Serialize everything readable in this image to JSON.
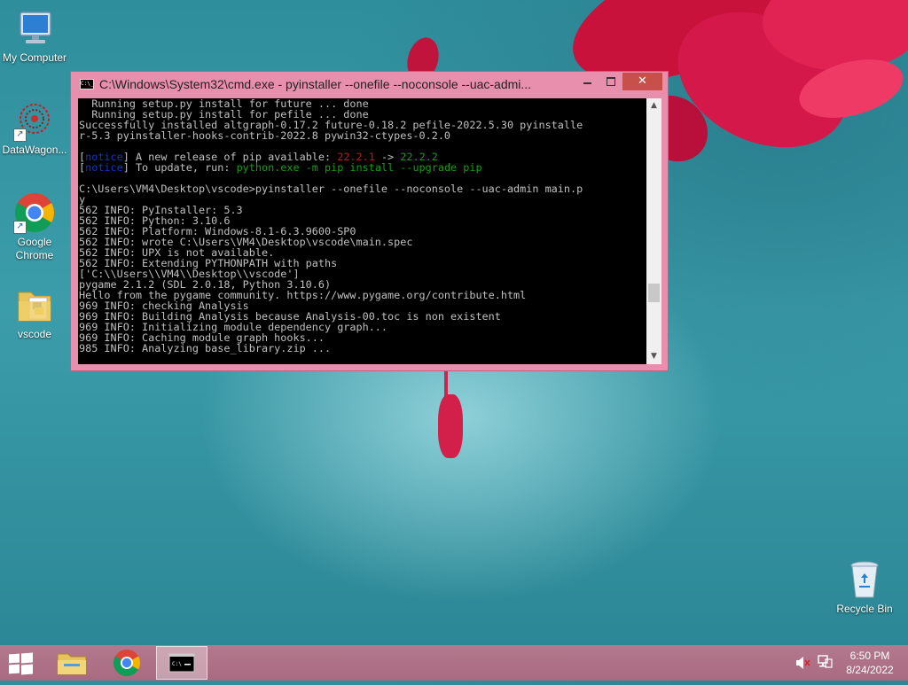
{
  "desktop": {
    "icons": [
      {
        "label": "My Computer",
        "icon": "computer-icon"
      },
      {
        "label": "DataWagon...",
        "icon": "datawagon-icon"
      },
      {
        "label": "Google Chrome",
        "icon": "chrome-icon"
      },
      {
        "label": "vscode",
        "icon": "folder-icon"
      },
      {
        "label": "Recycle Bin",
        "icon": "recycle-bin-icon"
      }
    ]
  },
  "window": {
    "title": "C:\\Windows\\System32\\cmd.exe - pyinstaller  --onefile --noconsole --uac-admi...",
    "close_label": "✕",
    "console_lines": [
      [
        {
          "t": "  Running setup.py install for future ... done"
        }
      ],
      [
        {
          "t": "  Running setup.py install for pefile ... done"
        }
      ],
      [
        {
          "t": "Successfully installed altgraph-0.17.2 future-0.18.2 pefile-2022.5.30 pyinstalle"
        }
      ],
      [
        {
          "t": "r-5.3 pyinstaller-hooks-contrib-2022.8 pywin32-ctypes-0.2.0"
        }
      ],
      [
        {
          "t": ""
        }
      ],
      [
        {
          "t": "["
        },
        {
          "t": "notice",
          "c": "blue"
        },
        {
          "t": "] A new release of pip available: "
        },
        {
          "t": "22.2.1",
          "c": "red"
        },
        {
          "t": " -> "
        },
        {
          "t": "22.2.2",
          "c": "green"
        }
      ],
      [
        {
          "t": "["
        },
        {
          "t": "notice",
          "c": "blue"
        },
        {
          "t": "] To update, run: "
        },
        {
          "t": "python.exe -m pip install --upgrade pip",
          "c": "green"
        }
      ],
      [
        {
          "t": ""
        }
      ],
      [
        {
          "t": "C:\\Users\\VM4\\Desktop\\vscode>pyinstaller --onefile --noconsole --uac-admin main.p"
        }
      ],
      [
        {
          "t": "y"
        }
      ],
      [
        {
          "t": "562 INFO: PyInstaller: 5.3"
        }
      ],
      [
        {
          "t": "562 INFO: Python: 3.10.6"
        }
      ],
      [
        {
          "t": "562 INFO: Platform: Windows-8.1-6.3.9600-SP0"
        }
      ],
      [
        {
          "t": "562 INFO: wrote C:\\Users\\VM4\\Desktop\\vscode\\main.spec"
        }
      ],
      [
        {
          "t": "562 INFO: UPX is not available."
        }
      ],
      [
        {
          "t": "562 INFO: Extending PYTHONPATH with paths"
        }
      ],
      [
        {
          "t": "['C:\\\\Users\\\\VM4\\\\Desktop\\\\vscode']"
        }
      ],
      [
        {
          "t": "pygame 2.1.2 (SDL 2.0.18, Python 3.10.6)"
        }
      ],
      [
        {
          "t": "Hello from the pygame community. https://www.pygame.org/contribute.html"
        }
      ],
      [
        {
          "t": "969 INFO: checking Analysis"
        }
      ],
      [
        {
          "t": "969 INFO: Building Analysis because Analysis-00.toc is non existent"
        }
      ],
      [
        {
          "t": "969 INFO: Initializing module dependency graph..."
        }
      ],
      [
        {
          "t": "969 INFO: Caching module graph hooks..."
        }
      ],
      [
        {
          "t": "985 INFO: Analyzing base_library.zip ..."
        }
      ]
    ],
    "scroll_up": "▲",
    "scroll_down": "▼"
  },
  "taskbar": {
    "apps": [
      {
        "name": "file-explorer",
        "active": false
      },
      {
        "name": "chrome",
        "active": false
      },
      {
        "name": "cmd",
        "active": true
      }
    ],
    "clock": {
      "time": "6:50 PM",
      "date": "8/24/2022"
    }
  },
  "colors": {
    "window_frame": "#e98fae",
    "close_button": "#c7504a",
    "console_bg": "#000000",
    "console_text": "#c0c0c0",
    "notice_blue": "#0a3ad0",
    "version_red": "#c01818",
    "cmd_green": "#13a10e"
  }
}
